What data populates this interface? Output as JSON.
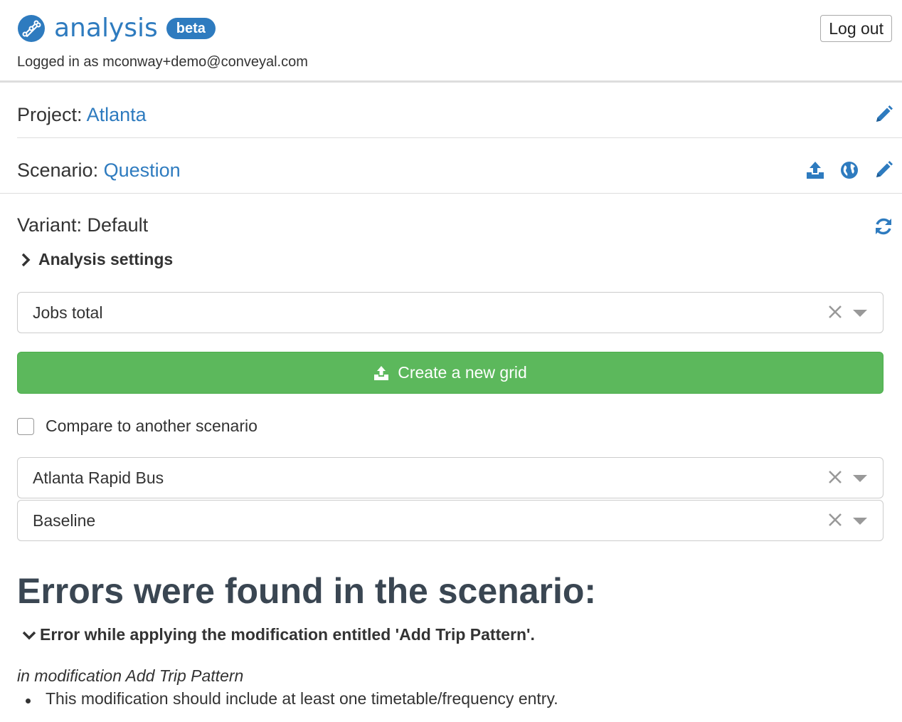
{
  "header": {
    "app_name": "analysis",
    "badge": "beta",
    "logged_in_text": "Logged in as mconway+demo@conveyal.com",
    "logout_label": "Log out"
  },
  "project": {
    "prefix": "Project:",
    "name": "Atlanta"
  },
  "scenario": {
    "prefix": "Scenario:",
    "name": "Question"
  },
  "variant": {
    "label": "Variant: Default"
  },
  "analysis_settings": {
    "label": "Analysis settings"
  },
  "opportunity_select": {
    "value": "Jobs total"
  },
  "create_grid_button": {
    "label": "Create a new grid"
  },
  "compare": {
    "label": "Compare to another scenario",
    "checked": false
  },
  "compare_scenario_select": {
    "value": "Atlanta Rapid Bus"
  },
  "compare_variant_select": {
    "value": "Baseline"
  },
  "errors": {
    "title": "Errors were found in the scenario:",
    "item_title": "Error while applying the modification entitled 'Add Trip Pattern'.",
    "modification_line": "in modification Add Trip Pattern",
    "messages": [
      "This modification should include at least one timetable/frequency entry."
    ]
  },
  "colors": {
    "accent": "#2e7bbf",
    "success": "#5cb85c",
    "border": "#dddddd"
  }
}
